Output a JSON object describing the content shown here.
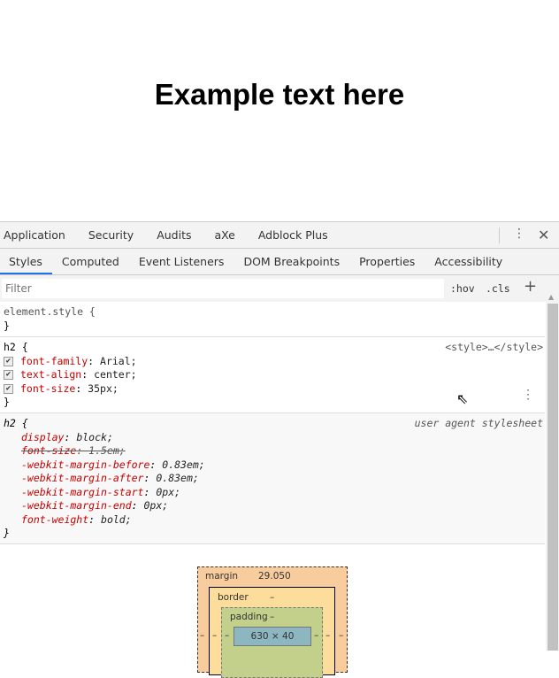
{
  "page": {
    "heading": "Example text here"
  },
  "devtools": {
    "top_tabs": [
      "Application",
      "Security",
      "Audits",
      "aXe",
      "Adblock Plus"
    ],
    "sub_tabs": [
      "Styles",
      "Computed",
      "Event Listeners",
      "DOM Breakpoints",
      "Properties",
      "Accessibility"
    ],
    "active_sub_tab": "Styles",
    "filter": {
      "placeholder": "Filter",
      "hov": ":hov",
      "cls": ".cls",
      "plus": "+"
    },
    "element_style": {
      "selector": "element.style {",
      "close": "}"
    },
    "rule1": {
      "selector": "h2 {",
      "source": "<style>…</style>",
      "close": "}",
      "props": [
        {
          "name": "font-family",
          "value": "Arial;"
        },
        {
          "name": "text-align",
          "value": "center;"
        },
        {
          "name": "font-size",
          "value": "35px;"
        }
      ]
    },
    "rule2": {
      "selector": "h2 {",
      "source": "user agent stylesheet",
      "close": "}",
      "props": [
        {
          "name": "display",
          "value": "block;"
        },
        {
          "name": "font-size",
          "value": "1.5em;"
        },
        {
          "name": "-webkit-margin-before",
          "value": "0.83em;"
        },
        {
          "name": "-webkit-margin-after",
          "value": "0.83em;"
        },
        {
          "name": "-webkit-margin-start",
          "value": "0px;"
        },
        {
          "name": "-webkit-margin-end",
          "value": "0px;"
        },
        {
          "name": "font-weight",
          "value": "bold;"
        }
      ]
    },
    "box_model": {
      "margin_label": "margin",
      "margin_top": "29.050",
      "border_label": "border",
      "border_top": "–",
      "padding_label": "padding",
      "padding_top": "–",
      "content": "630 × 40",
      "dash": "–"
    }
  }
}
